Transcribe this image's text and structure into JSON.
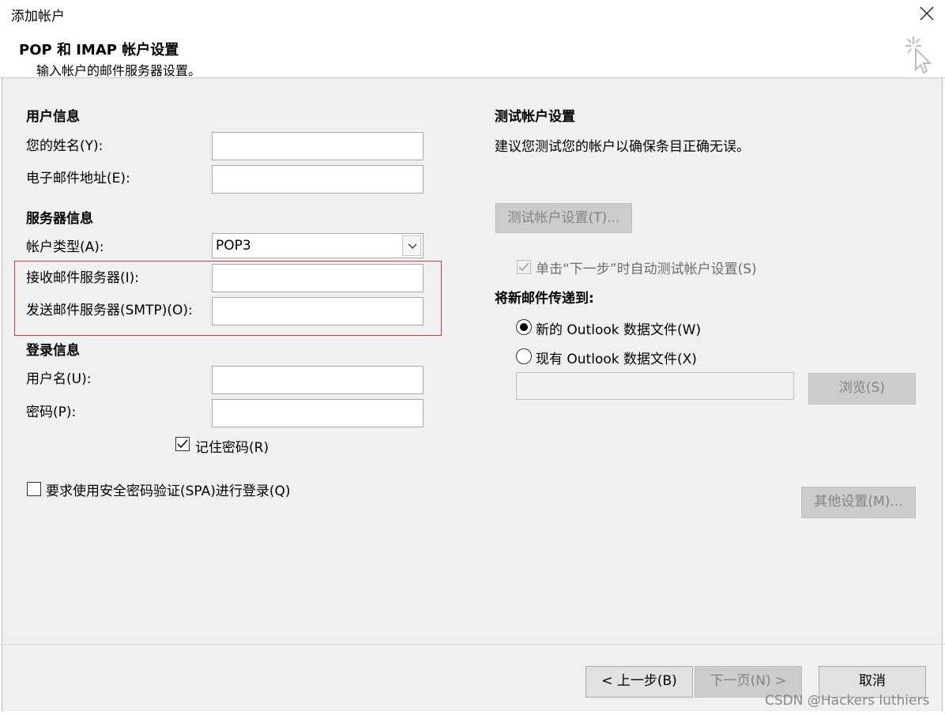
{
  "window": {
    "title": "添加帐户",
    "close_icon": "close-icon"
  },
  "header": {
    "title": "POP 和 IMAP 帐户设置",
    "subtitle": "输入帐户的邮件服务器设置。",
    "icon": "wizard-sparkle-cursor-icon"
  },
  "user_info": {
    "section": "用户信息",
    "name_label": "您的姓名(Y):",
    "name_value": "",
    "email_label": "电子邮件地址(E):",
    "email_value": ""
  },
  "server_info": {
    "section": "服务器信息",
    "account_type_label": "帐户类型(A):",
    "account_type_value": "POP3",
    "incoming_label": "接收邮件服务器(I):",
    "incoming_value": "",
    "outgoing_label": "发送邮件服务器(SMTP)(O):",
    "outgoing_value": ""
  },
  "login_info": {
    "section": "登录信息",
    "username_label": "用户名(U):",
    "username_value": "",
    "password_label": "密码(P):",
    "password_value": "",
    "remember_password_label": "记住密码(R)",
    "remember_password_checked": true,
    "spa_label": "要求使用安全密码验证(SPA)进行登录(Q)",
    "spa_checked": false
  },
  "test_settings": {
    "section": "测试帐户设置",
    "description": "建议您测试您的帐户以确保条目正确无误。",
    "test_button": "测试帐户设置(T)...",
    "auto_test_label": "单击“下一步”时自动测试帐户设置(S)",
    "auto_test_checked": true
  },
  "deliver_to": {
    "section": "将新邮件传递到:",
    "new_file_label": "新的 Outlook 数据文件(W)",
    "existing_file_label": "现有 Outlook 数据文件(X)",
    "selected": "new_file",
    "existing_path_value": "",
    "browse_button": "浏览(S)"
  },
  "more_settings_button": "其他设置(M)...",
  "footer": {
    "back_button": "< 上一步(B)",
    "next_button": "下一页(N) >",
    "cancel_button": "取消"
  },
  "colors": {
    "highlight_border": "#d9383a",
    "disabled_button": "#cccccc",
    "dialog_bg": "#f0f0f0"
  },
  "watermark": "CSDN @Hackers luthiers"
}
